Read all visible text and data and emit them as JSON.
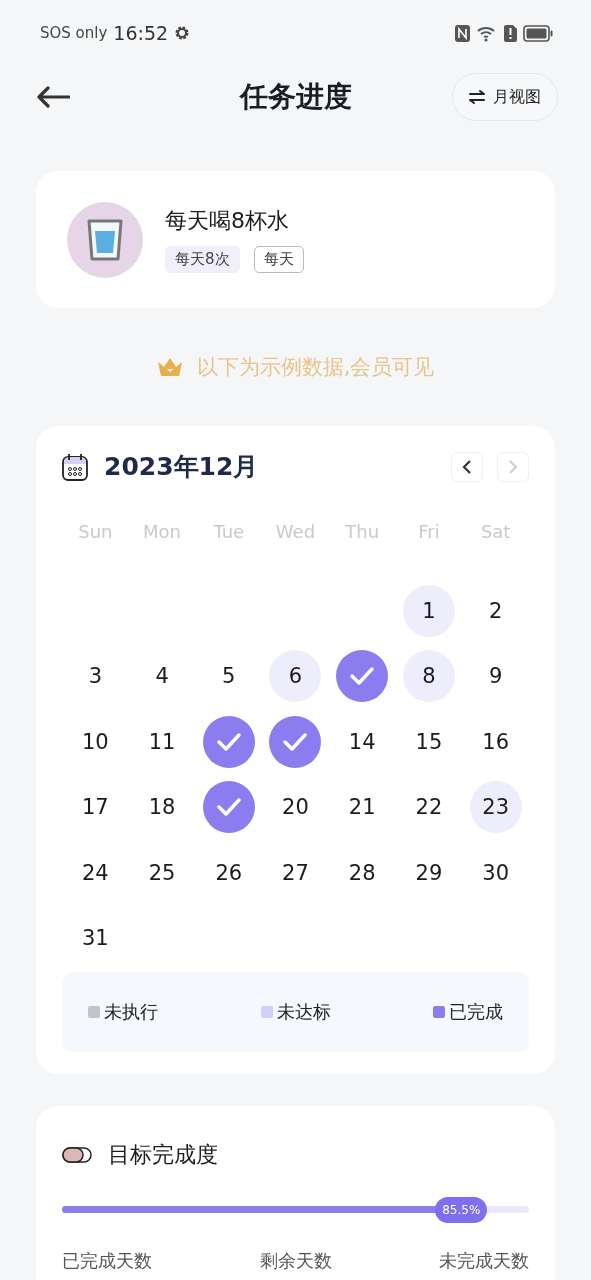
{
  "status_bar": {
    "carrier": "SOS only",
    "time": "16:52"
  },
  "header": {
    "title": "任务进度",
    "view_button": "月视图"
  },
  "task": {
    "name": "每天喝8杯水",
    "tags": [
      {
        "label": "每天8次",
        "kind": "filled"
      },
      {
        "label": "每天",
        "kind": "outline"
      }
    ]
  },
  "notice": "以下为示例数据,会员可见",
  "calendar": {
    "month": "2023年12月",
    "prev_disabled": false,
    "next_disabled": true,
    "weekdays": [
      "Sun",
      "Mon",
      "Tue",
      "Wed",
      "Thu",
      "Fri",
      "Sat"
    ],
    "weeks": [
      [
        {
          "label": "1",
          "checked": false,
          "highlighted": true
        },
        {
          "label": "2",
          "checked": false,
          "highlighted": false
        }
      ],
      [
        {
          "label": "3",
          "checked": false,
          "highlighted": false
        },
        {
          "label": "4",
          "checked": false,
          "highlighted": false
        },
        {
          "label": "5",
          "checked": false,
          "highlighted": false
        },
        {
          "label": "6",
          "checked": false,
          "highlighted": true
        },
        {
          "checked": true
        },
        {
          "label": "8",
          "checked": false,
          "highlighted": true
        },
        {
          "label": "9",
          "checked": false,
          "highlighted": false
        }
      ],
      [
        {
          "label": "10",
          "checked": false,
          "highlighted": false
        },
        {
          "label": "11",
          "checked": false,
          "highlighted": false
        },
        {
          "checked": true
        },
        {
          "checked": true
        },
        {
          "label": "14",
          "checked": false,
          "highlighted": false
        },
        {
          "label": "15",
          "checked": false,
          "highlighted": false
        },
        {
          "label": "16",
          "checked": false,
          "highlighted": false
        }
      ],
      [
        {
          "label": "17",
          "checked": false,
          "highlighted": false
        },
        {
          "label": "18",
          "checked": false,
          "highlighted": false
        },
        {
          "checked": true
        },
        {
          "label": "20",
          "checked": false,
          "highlighted": false
        },
        {
          "label": "21",
          "checked": false,
          "highlighted": false
        },
        {
          "label": "22",
          "checked": false,
          "highlighted": false
        },
        {
          "label": "23",
          "checked": false,
          "highlighted": true
        }
      ],
      [
        {
          "label": "24",
          "checked": false,
          "highlighted": false
        },
        {
          "label": "25",
          "checked": false,
          "highlighted": false
        },
        {
          "label": "26",
          "checked": false,
          "highlighted": false
        },
        {
          "label": "27",
          "checked": false,
          "highlighted": false
        },
        {
          "label": "28",
          "checked": false,
          "highlighted": false
        },
        {
          "label": "29",
          "checked": false,
          "highlighted": false
        },
        {
          "label": "30",
          "checked": false,
          "highlighted": false
        }
      ],
      [
        {
          "label": "31",
          "checked": false,
          "highlighted": false
        }
      ]
    ],
    "legend": [
      {
        "label": "未执行",
        "color": "#c4c4cc"
      },
      {
        "label": "未达标",
        "color": "#d3cdf7"
      },
      {
        "label": "已完成",
        "color": "#8b7cf0"
      }
    ]
  },
  "progress": {
    "title": "目标完成度",
    "level": 0.855,
    "reading": "85.5%",
    "stats": [
      "已完成天数",
      "剩余天数",
      "未完成天数"
    ]
  }
}
